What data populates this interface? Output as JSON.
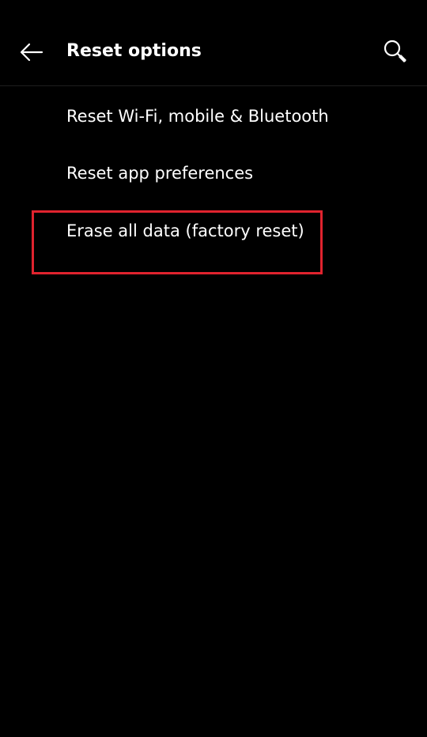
{
  "app_bar": {
    "title": "Reset options",
    "back_icon": "arrow-left-icon",
    "search_icon": "search-icon"
  },
  "options": [
    {
      "label": "Reset Wi-Fi, mobile & Bluetooth"
    },
    {
      "label": "Reset app preferences"
    },
    {
      "label": "Erase all data (factory reset)"
    }
  ],
  "colors": {
    "background": "#000000",
    "text": "#ffffff",
    "highlight": "#e0232e"
  }
}
